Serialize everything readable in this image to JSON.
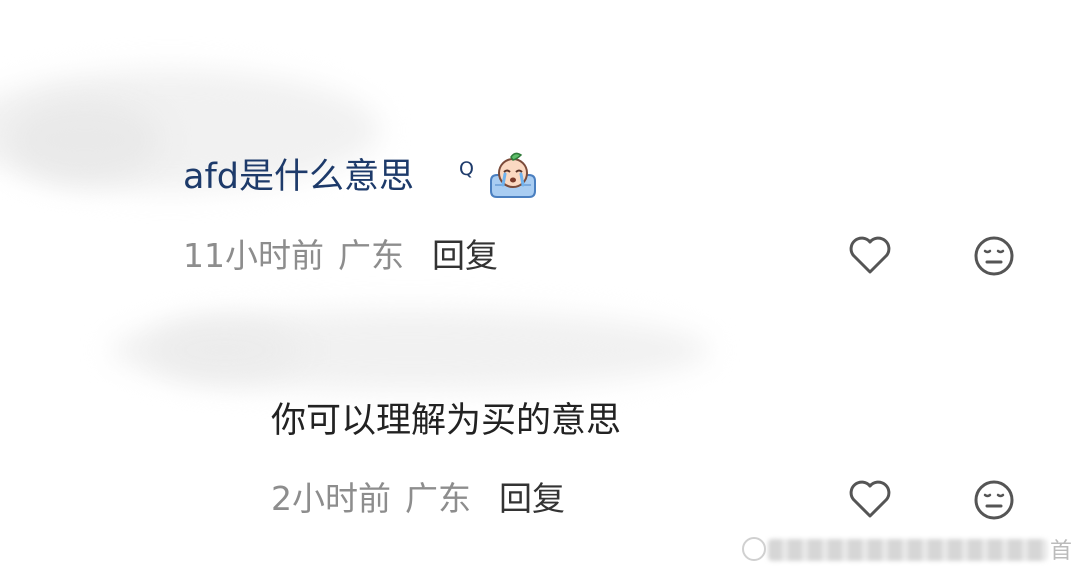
{
  "comments": [
    {
      "text": "afd是什么意思",
      "search_mark": "Q",
      "emoji_icon": "crying-face-emoji-icon",
      "time": "11小时前",
      "location": "广东",
      "reply_label": "回复"
    },
    {
      "text": "你可以理解为买的意思",
      "time": "2小时前",
      "location": "广东",
      "reply_label": "回复"
    }
  ],
  "icons": {
    "like": "heart-outline-icon",
    "react": "neutral-face-icon"
  },
  "watermark": {
    "char": "首"
  },
  "colors": {
    "comment_link": "#1d3a6a",
    "meta_gray": "#8d8d8d",
    "reply_dark": "#333333"
  }
}
